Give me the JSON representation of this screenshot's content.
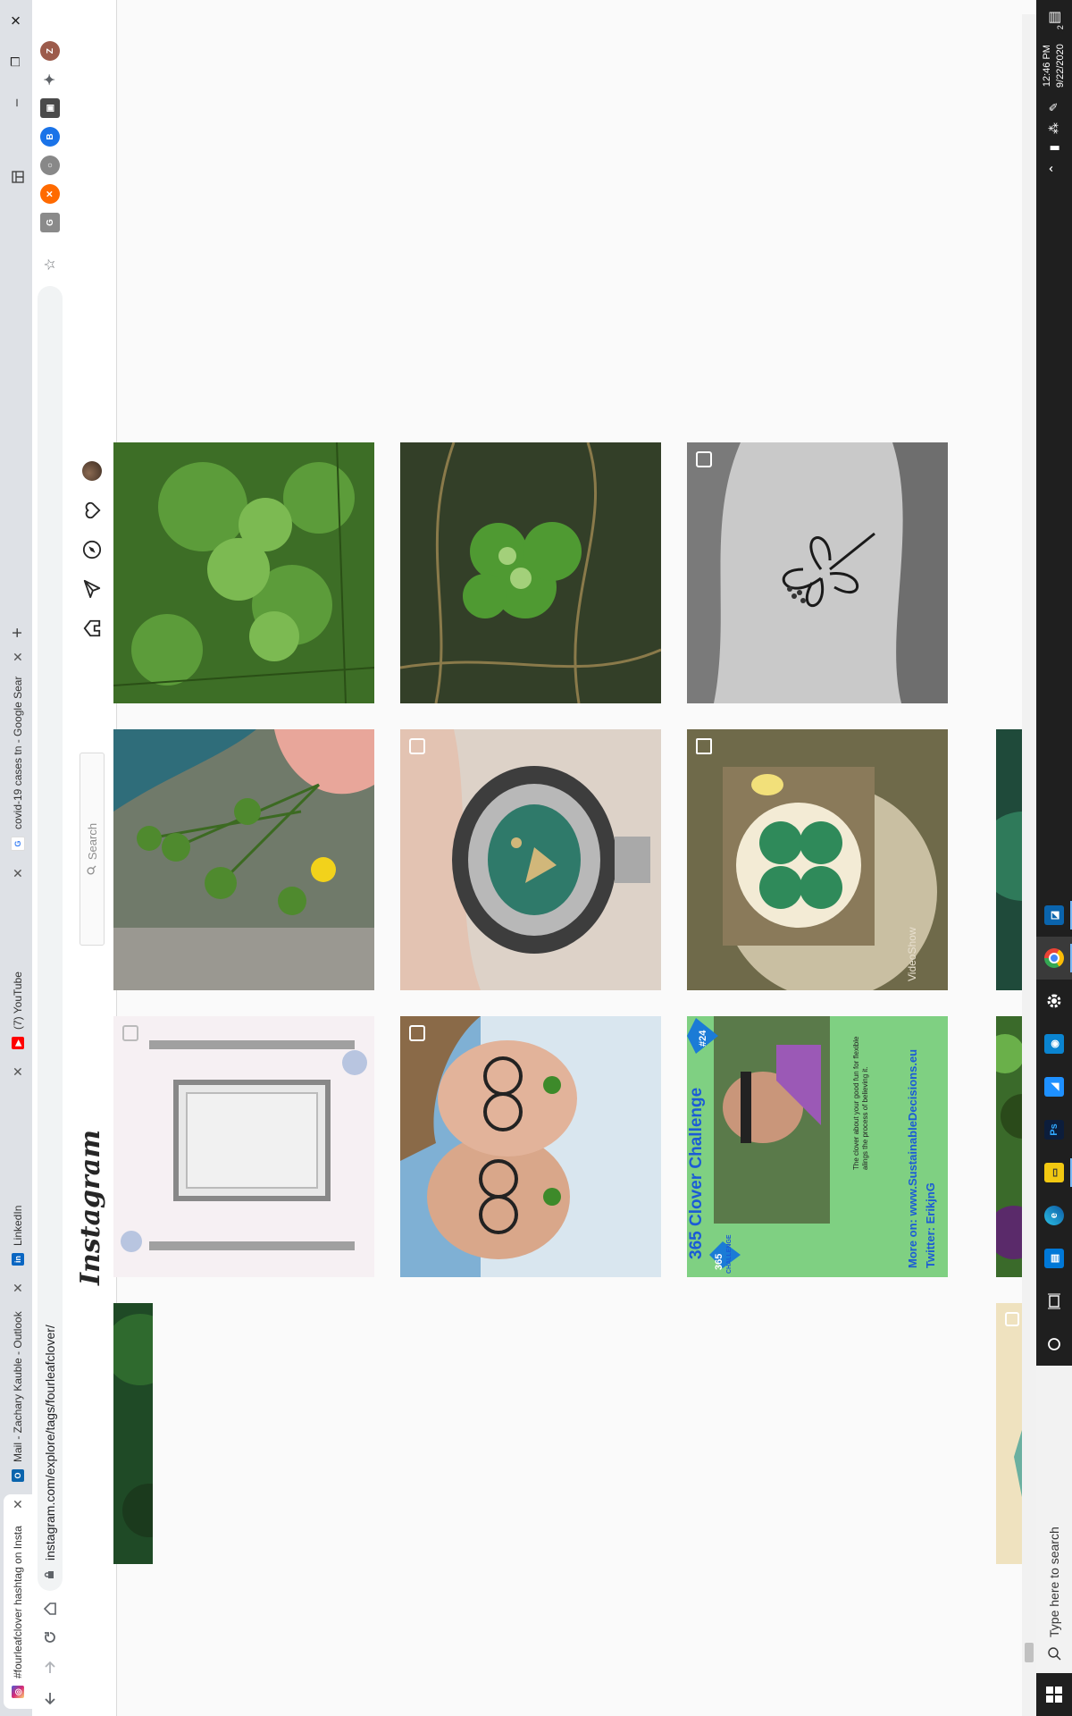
{
  "browser": {
    "tabs": [
      {
        "title": "#fourleafclover hashtag on Insta",
        "favicon": "instagram-icon",
        "color": "#d62976",
        "active": true
      },
      {
        "title": "Mail - Zachary Kauble - Outlook",
        "favicon": "outlook-icon",
        "color": "#0a64ad",
        "active": false
      },
      {
        "title": "LinkedIn",
        "favicon": "linkedin-icon",
        "color": "#0a66c2",
        "active": false
      },
      {
        "title": "(7) YouTube",
        "favicon": "youtube-icon",
        "color": "#ff0000",
        "active": false
      },
      {
        "title": "covid-19 cases tn - Google Sear",
        "favicon": "google-icon",
        "color": "#4285f4",
        "active": false
      }
    ],
    "url": "instagram.com/explore/tags/fourleafclover/",
    "new_tab": "+",
    "window_controls": {
      "minimize": "–",
      "restore": "❐",
      "close": "✕"
    }
  },
  "instagram": {
    "logo": "Instagram",
    "search_placeholder": "Search",
    "nav_icons": [
      "home-icon",
      "direct-icon",
      "explore-icon",
      "activity-icon",
      "profile-avatar"
    ]
  },
  "grid": {
    "rows": [
      {
        "tiles": [
          {
            "desc": "clover-with-yellow-flower-in-hand",
            "badge": "none"
          },
          {
            "desc": "frame-with-columns",
            "badge": "carousel"
          },
          {
            "desc": "dark-green-leaf-partial",
            "badge": "none"
          }
        ]
      },
      {
        "tiles": [
          {
            "desc": "turquoise-silver-pendant",
            "badge": "carousel"
          },
          {
            "desc": "couple-selfie-with-clover",
            "badge": "carousel"
          },
          {
            "desc": "purple-green-plant-partial",
            "badge": "none"
          }
        ]
      },
      {
        "tiles": [
          {
            "desc": "clover-painting-videoshow",
            "badge": "video"
          },
          {
            "desc": "365-clover-challenge-card",
            "badge": "none"
          },
          {
            "desc": "teal-partial",
            "badge": "carousel"
          }
        ]
      }
    ],
    "right_col": [
      {
        "desc": "clover-patch-grass",
        "badge": "none"
      },
      {
        "desc": "four-leaf-clover-in-grass",
        "badge": "none"
      },
      {
        "desc": "clover-tattoo-on-hand",
        "badge": "carousel"
      }
    ],
    "challenge_card": {
      "title": "365 Clover Challenge",
      "badge_top": "365",
      "badge_top_sub": "CHALLENGE",
      "day": "#24",
      "caption": "The clover about your good fun for flexible alings the process of believing it.",
      "more": "More on: www.SustainableDecisions.eu",
      "twitter": "Twitter: ErikjnG"
    },
    "videoshow_watermark": "VideoShow"
  },
  "taskbar": {
    "search_placeholder": "Type here to search",
    "time": "12:46 PM",
    "date": "9/22/2020",
    "notification_count": "2"
  }
}
